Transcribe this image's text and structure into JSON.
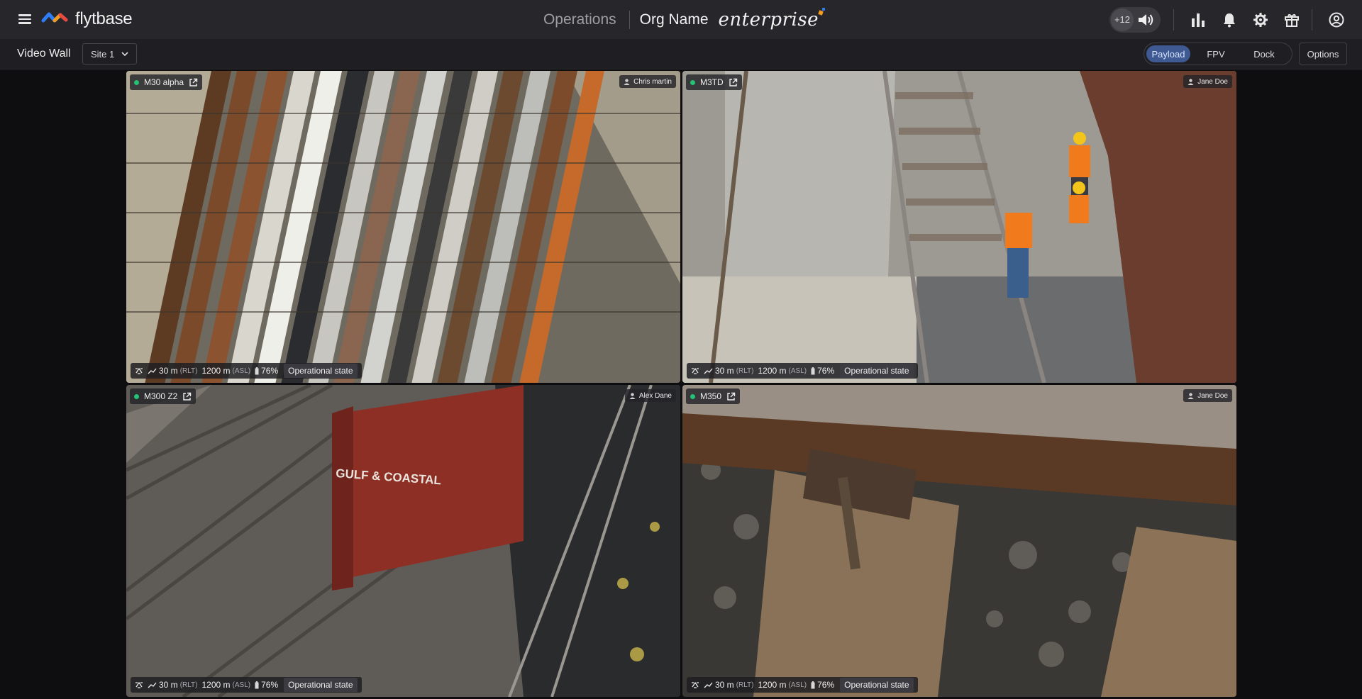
{
  "header": {
    "brand": "flytbase",
    "section": "Operations",
    "org_name": "Org Name",
    "plan": "enterprise",
    "audio_count": "+12",
    "icons": [
      "menu-icon",
      "speaker-icon",
      "analytics-icon",
      "bell-icon",
      "gear-icon",
      "gift-icon",
      "account-icon"
    ]
  },
  "subbar": {
    "title": "Video Wall",
    "site": "Site 1",
    "views": [
      "Payload",
      "FPV",
      "Dock"
    ],
    "active_view": "Payload",
    "options_label": "Options"
  },
  "tiles": [
    {
      "drone": "M30 alpha",
      "pilot": "Chris martin",
      "rlt": "30 m",
      "rlt_unit": "(RLT)",
      "asl": "1200 m",
      "asl_unit": "(ASL)",
      "battery": "76%",
      "state": "Operational state"
    },
    {
      "drone": "M3TD",
      "pilot": "Jane Doe",
      "rlt": "30 m",
      "rlt_unit": "(RLT)",
      "asl": "1200 m",
      "asl_unit": "(ASL)",
      "battery": "76%",
      "state": "Operational state"
    },
    {
      "drone": "M300 Z2",
      "pilot": "Alex Dane",
      "rlt": "30 m",
      "rlt_unit": "(RLT)",
      "asl": "1200 m",
      "asl_unit": "(ASL)",
      "battery": "76%",
      "state": "Operational state"
    },
    {
      "drone": "M350",
      "pilot": "Jane Doe",
      "rlt": "30 m",
      "rlt_unit": "(RLT)",
      "asl": "1200 m",
      "asl_unit": "(ASL)",
      "battery": "76%",
      "state": "Operational state"
    }
  ],
  "scene_text": {
    "boxcar_marking": "GULF & COASTAL"
  },
  "colors": {
    "accent_blue": "#3f5a93",
    "status_green": "#25c177",
    "topbar_bg": "#27272b"
  }
}
